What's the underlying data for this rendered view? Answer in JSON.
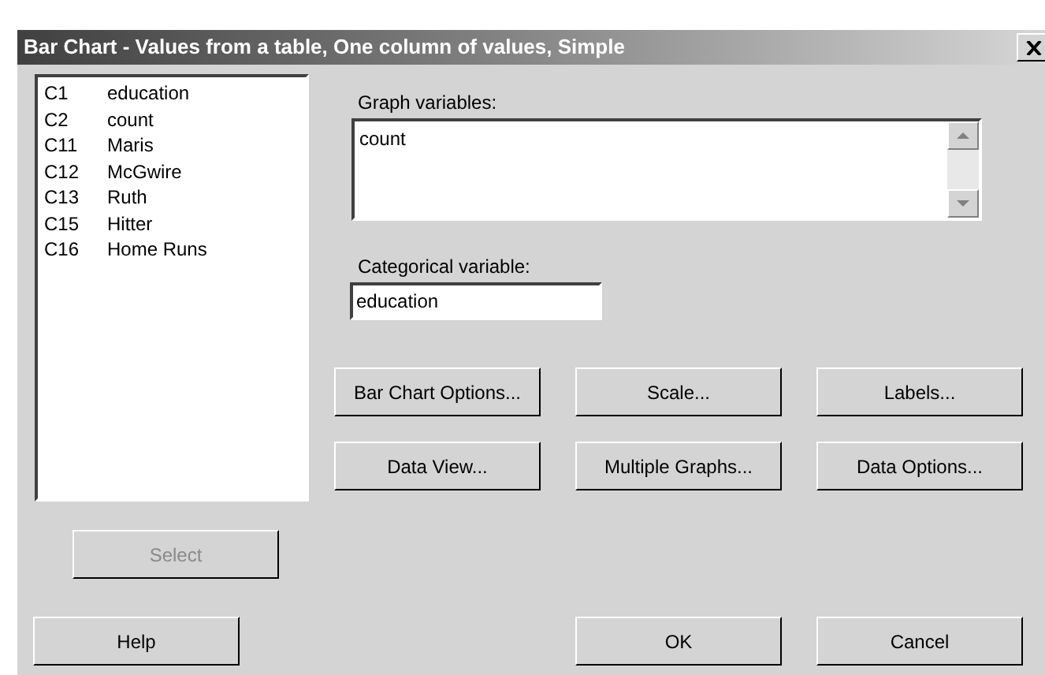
{
  "window": {
    "title": "Bar Chart - Values from a table, One column of values, Simple"
  },
  "variables": [
    {
      "column": "C1",
      "name": "education"
    },
    {
      "column": "C2",
      "name": "count"
    },
    {
      "column": "C11",
      "name": "Maris"
    },
    {
      "column": "C12",
      "name": "McGwire"
    },
    {
      "column": "C13",
      "name": "Ruth"
    },
    {
      "column": "C15",
      "name": "Hitter"
    },
    {
      "column": "C16",
      "name": "Home Runs"
    }
  ],
  "select_button": {
    "label": "Select",
    "disabled": true
  },
  "graph_variables": {
    "label": "Graph variables:",
    "value": "count"
  },
  "categorical_variable": {
    "label": "Categorical variable:",
    "value": "education"
  },
  "option_buttons": [
    "Bar Chart Options...",
    "Scale...",
    "Labels...",
    "Data View...",
    "Multiple Graphs...",
    "Data Options..."
  ],
  "help_button": "Help",
  "ok_button": "OK",
  "cancel_button": "Cancel"
}
